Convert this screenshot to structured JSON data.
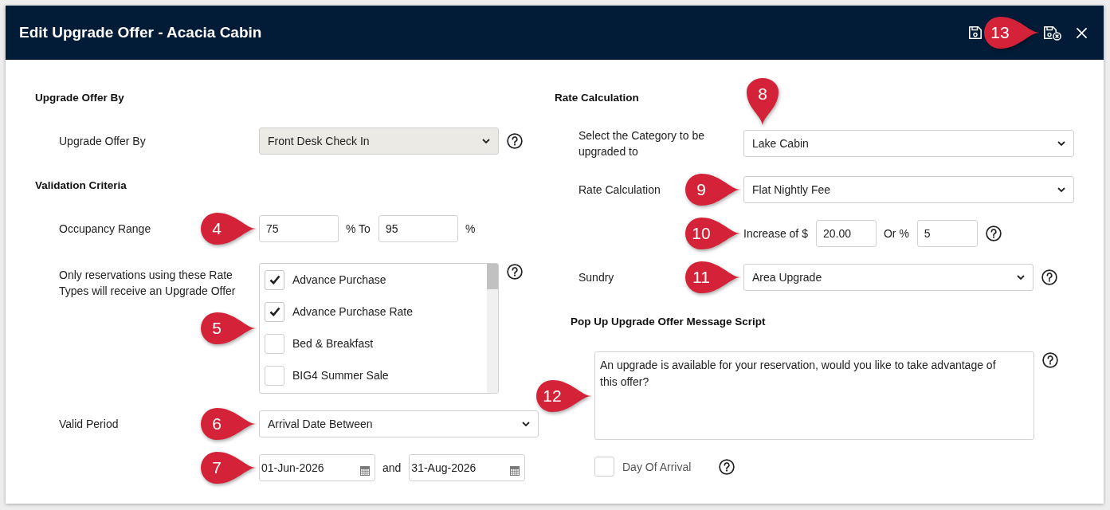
{
  "window": {
    "title": "Edit Upgrade Offer - Acacia Cabin",
    "actions": [
      {
        "kind": "save"
      },
      {
        "kind": "save_close",
        "callout": {
          "number": "13",
          "kind": "right"
        }
      },
      {
        "kind": "close"
      }
    ]
  },
  "upgrade_offer_by": {
    "heading": "Upgrade Offer By",
    "field": {
      "label": "Upgrade Offer By",
      "value": "Front Desk Check In",
      "disabled": true,
      "help": true
    }
  },
  "validation_criteria": {
    "heading": "Validation Criteria",
    "occupancy_range": {
      "label": "Occupancy Range",
      "from": "75",
      "to_label": "% To",
      "to": "95",
      "unit": "%",
      "callout": {
        "number": "4",
        "kind": "right"
      }
    },
    "rate_types": {
      "label": "Only reservations using these Rate Types will receive an Upgrade Offer",
      "help": true,
      "callout": {
        "number": "5",
        "kind": "right"
      },
      "items": [
        {
          "label": "Advance Purchase",
          "checked": true
        },
        {
          "label": "Advance Purchase Rate",
          "checked": true
        },
        {
          "label": "Bed & Breakfast",
          "checked": false
        },
        {
          "label": "BIG4 Summer Sale",
          "checked": false
        }
      ]
    },
    "valid_period": {
      "label": "Valid Period",
      "value": "Arrival Date Between",
      "callout": {
        "number": "6",
        "kind": "right"
      }
    },
    "dates": {
      "from": "01-Jun-2026",
      "joiner": "and",
      "to": "31-Aug-2026",
      "callout": {
        "number": "7",
        "kind": "right"
      }
    }
  },
  "rate_calculation": {
    "heading": "Rate Calculation",
    "category": {
      "label": "Select the Category to be upgraded to",
      "value": "Lake Cabin",
      "callout": {
        "number": "8",
        "kind": "down"
      }
    },
    "calculation": {
      "label": "Rate Calculation",
      "value": "Flat Nightly Fee",
      "callout": {
        "number": "9",
        "kind": "right"
      }
    },
    "increase": {
      "amount_label": "Increase of $",
      "amount": "20.00",
      "percent_label": "Or %",
      "percent": "5",
      "help": true,
      "callout": {
        "number": "10",
        "kind": "right"
      }
    },
    "sundry": {
      "label": "Sundry",
      "value": "Area Upgrade",
      "help": true,
      "callout": {
        "number": "11",
        "kind": "right"
      }
    }
  },
  "message_script": {
    "heading": "Pop Up Upgrade Offer Message Script",
    "message": "An upgrade is available for your reservation, would you like to take advantage of this offer?",
    "help": true,
    "callout": {
      "number": "12",
      "kind": "right"
    },
    "day_of_arrival": {
      "label": "Day Of Arrival",
      "checked": false,
      "help": true
    }
  }
}
